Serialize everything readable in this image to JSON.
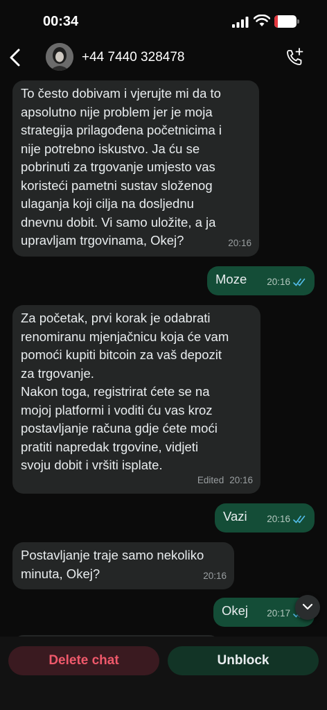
{
  "status_bar": {
    "time": "00:34",
    "battery": "16",
    "battery_level_percent": 16
  },
  "header": {
    "contact": "+44 7440 328478",
    "back_icon": "chevron-left-icon",
    "action_icon": "phone-plus-icon"
  },
  "messages": [
    {
      "dir": "in",
      "text": "To često dobivam i vjerujte mi da to\napsolutno nije problem jer je moja\nstrategija prilagođena početnicima i\nnije potrebno iskustvo. Ja ću se\npobrinuti za trgovanje umjesto vas\nkoristeći pametni sustav složenog\nulaganja koji cilja na dosljednu\ndnevnu dobit. Vi samo uložite, a ja\nupravljam trgovinama, Okej?",
      "time": "20:16"
    },
    {
      "dir": "out",
      "text": "Moze",
      "time": "20:16",
      "read": true
    },
    {
      "dir": "in",
      "text": "Za početak, prvi korak je odabrati\nrenomiranu mjenjačnicu koja će vam\npomoći kupiti bitcoin za vaš depozit\nza trgovanje.\nNakon toga, registrirat ćete se na\nmojoj platformi i voditi ću vas kroz\npostavljanje računa gdje ćete moći\npratiti napredak trgovine, vidjeti\nsvoju dobit i vršiti isplate.",
      "edited": "Edited",
      "time": "20:16"
    },
    {
      "dir": "out",
      "text": "Vazi",
      "time": "20:16",
      "read": true
    },
    {
      "dir": "in",
      "text": "Postavljanje traje samo nekoliko\nminuta, Okej?",
      "time": "20:16"
    },
    {
      "dir": "out",
      "text": "Okej",
      "time": "20:17",
      "read": true
    }
  ],
  "actions": {
    "delete": "Delete chat",
    "unblock": "Unblock"
  },
  "colors": {
    "incoming": "#242626",
    "outgoing": "#144d37",
    "read_tick": "#53bdeb",
    "delete": "#f0596b"
  }
}
